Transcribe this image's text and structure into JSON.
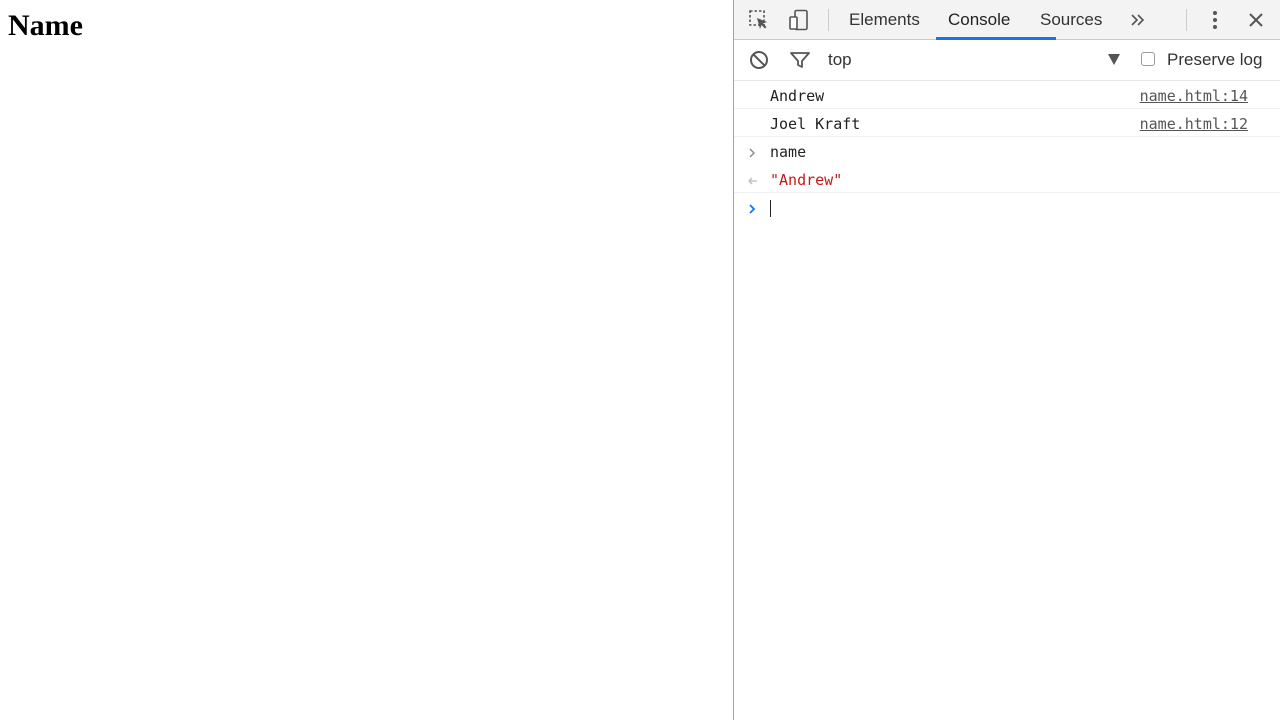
{
  "page": {
    "heading": "Name"
  },
  "devtools": {
    "tabs": [
      {
        "label": "Elements",
        "active": false
      },
      {
        "label": "Console",
        "active": true
      },
      {
        "label": "Sources",
        "active": false
      }
    ],
    "toolbar": {
      "context": "top",
      "preserve_log_label": "Preserve log",
      "preserve_log_checked": false
    },
    "console": {
      "logs": [
        {
          "text": "Andrew",
          "source": "name.html:14"
        },
        {
          "text": "Joel Kraft",
          "source": "name.html:12"
        }
      ],
      "input_command": "name",
      "result": "\"Andrew\"",
      "prompt_value": ""
    },
    "colors": {
      "accent": "#1a73e8",
      "string": "#c41a16",
      "prompt_arrow": "#1a73e8"
    },
    "icons": [
      "inspect-icon",
      "device-toolbar-icon",
      "more-tabs-icon",
      "kebab-menu-icon",
      "close-icon",
      "clear-console-icon",
      "filter-icon",
      "dropdown-arrow-icon",
      "expand-chevron-icon",
      "return-arrow-icon",
      "prompt-chevron-icon"
    ]
  }
}
